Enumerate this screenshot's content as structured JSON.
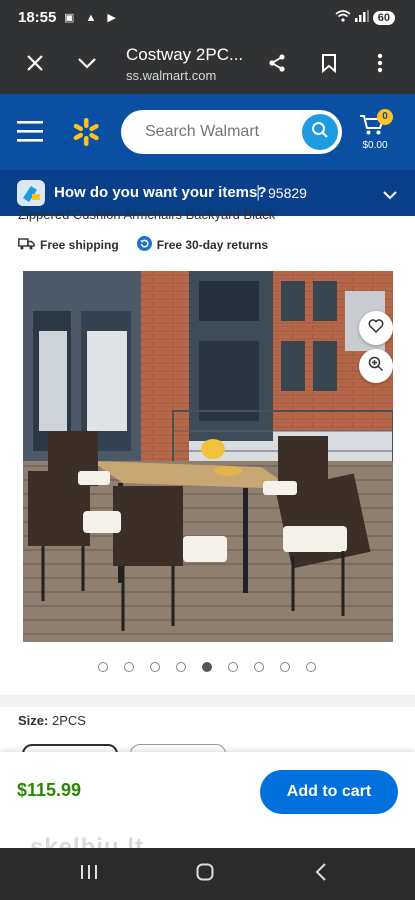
{
  "status_bar": {
    "time": "18:55",
    "battery": "60"
  },
  "browser": {
    "page_title": "Costway 2PC...",
    "url": "ss.walmart.com"
  },
  "header": {
    "search_placeholder": "Search Walmart",
    "cart_count": "0",
    "cart_total": "$0.00"
  },
  "fulfillment": {
    "question": "How do you want your items?",
    "separator": "|",
    "zip": "95829"
  },
  "product": {
    "title_fragment": "Zippered Cushion Armchairs Backyard Black",
    "badge_shipping": "Free shipping",
    "badge_returns": "Free 30-day returns",
    "carousel_count": 9,
    "carousel_active_index": 4,
    "size_label": "Size:",
    "size_value": "2PCS"
  },
  "buy_bar": {
    "price": "$115.99",
    "add_to_cart": "Add to cart"
  },
  "watermark": "skelbiu.lt",
  "colors": {
    "walmart_blue": "#0b4fa3",
    "spark_yellow": "#ffc220",
    "price_green": "#2a8703",
    "button_blue": "#0071dc"
  }
}
